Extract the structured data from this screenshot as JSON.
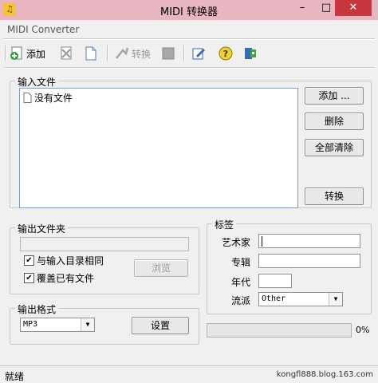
{
  "window": {
    "title": "MIDI 转换器",
    "subtitle": "MIDI Converter",
    "controls": {
      "minimize": "–",
      "maximize": "□",
      "close": "✕"
    }
  },
  "toolbar": {
    "add_label": "添加",
    "convert_label": "转换",
    "icons": [
      "add-icon",
      "remove-icon",
      "new-document-icon",
      "convert-icon",
      "stop-icon",
      "edit-icon",
      "help-icon",
      "exit-icon"
    ]
  },
  "input_files": {
    "title": "输入文件",
    "items": [
      "没有文件"
    ],
    "buttons": {
      "add": "添加 ...",
      "delete": "删除",
      "clear_all": "全部清除",
      "convert": "转换"
    }
  },
  "output_folder": {
    "title": "输出文件夹",
    "path": "",
    "browse": "浏览",
    "same_dir_label": "与输入目录相同",
    "same_dir_checked": true,
    "overwrite_label": "覆盖已有文件",
    "overwrite_checked": true
  },
  "tags": {
    "title": "标签",
    "artist_label": "艺术家",
    "artist": "",
    "album_label": "专辑",
    "album": "",
    "year_label": "年代",
    "year": "",
    "genre_label": "流派",
    "genre": "Other"
  },
  "output_format": {
    "title": "输出格式",
    "format": "MP3",
    "settings": "设置"
  },
  "progress": {
    "value": 0,
    "text": "0%"
  },
  "status": {
    "left": "就绪",
    "right": "kongfl888.blog.163.com"
  },
  "colors": {
    "titlebar": "#e7b6c1",
    "close": "#c7373d",
    "background": "#f0f0f0"
  }
}
